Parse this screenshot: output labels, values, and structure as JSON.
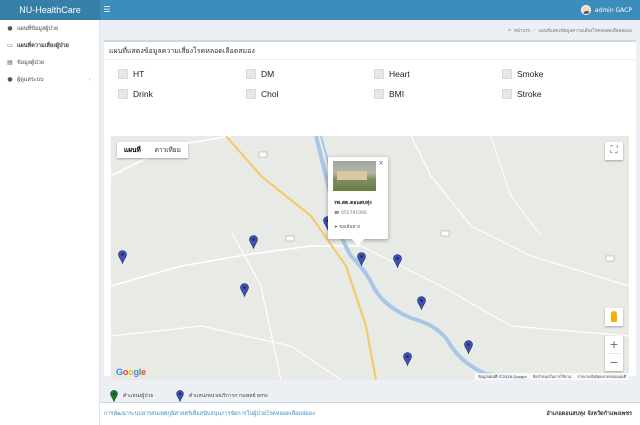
{
  "app": {
    "title": "NU-HealthCare",
    "menu_icon": "hamburger-icon"
  },
  "user": {
    "name": "admin GACP"
  },
  "sidebar": {
    "items": [
      {
        "label": "แผนที่ข้อมูลผู้ป่วย",
        "icon": "map-marker-icon"
      },
      {
        "label": "แผนที่ความเสี่ยงผู้ป่วย",
        "icon": "map-icon"
      },
      {
        "label": "ข้อมูลผู้ป่วย",
        "icon": "table-icon"
      },
      {
        "label": "ผู้ดูแลระบบ",
        "icon": "user-icon"
      }
    ]
  },
  "breadcrumb": {
    "home": "หน้าแรก",
    "current": "แผนที่แสดงข้อมูลความเสี่ยงโรคหลอดเลือดสมอง"
  },
  "panel": {
    "title": "แผนที่แสดงข้อมูลความเสี่ยงโรคหลอดเลือดสมอง"
  },
  "filters": [
    {
      "label": "HT",
      "checked": false
    },
    {
      "label": "DM",
      "checked": false
    },
    {
      "label": "Heart",
      "checked": false
    },
    {
      "label": "Smoke",
      "checked": false
    },
    {
      "label": "Drink",
      "checked": false
    },
    {
      "label": "Chol",
      "checked": false
    },
    {
      "label": "BMI",
      "checked": false
    },
    {
      "label": "Stroke",
      "checked": false
    }
  ],
  "map": {
    "type_tabs": [
      "แผนที่",
      "ดาวเทียม"
    ],
    "active_tab": "แผนที่",
    "attribution": [
      "ข้อมูลแผนที่ ©2018 Google",
      "ข้อกำหนดในการใช้งาน",
      "รายงานข้อผิดพลาดของแผนที่"
    ],
    "infowindow": {
      "name": "รพ.สต.ดอนสบทุ่ง",
      "phone": "055791006",
      "directions": "ขอเส้นทาง"
    },
    "marker_color": "#3f51b5",
    "patient_marker_color": "#1b7a2b"
  },
  "legend": {
    "patient": "ตำแหน่งผู้ป่วย",
    "facility": "ตำแหน่งหน่วยบริการการแพทย์ ems"
  },
  "footer": {
    "left": "การพัฒนาระบบสารสนเทศภูมิศาสตร์เพื่อสนับสนุนการจัดการในผู้ป่วยโรคหลอดเลือดสมอง",
    "right": "อำเภอดอนสบทุ่ง จังหวัดกำแพงเพชร"
  }
}
